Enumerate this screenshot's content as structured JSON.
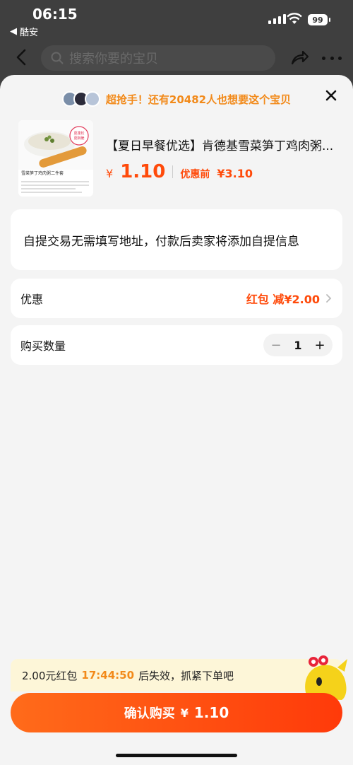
{
  "status_bar": {
    "time": "06:15",
    "back_app": "酷安",
    "battery": "99"
  },
  "nav": {
    "search_placeholder": "搜索你要的宝贝"
  },
  "sheet": {
    "promo_text": "超抢手！还有20482人也想要这个宝贝",
    "product": {
      "title": "【夏日早餐优选】肯德基雪菜笋丁鸡肉粥...",
      "thumb_caption": "雪菜笋丁鸡肉粥二件套",
      "price_symbol": "¥",
      "price": "1.10",
      "original_label": "优惠前",
      "original_price": "¥3.10"
    },
    "pickup_notice": "自提交易无需填写地址，付款后卖家将添加自提信息",
    "discount": {
      "label": "优惠",
      "value": "红包 减¥2.00"
    },
    "quantity": {
      "label": "购买数量",
      "value": "1",
      "minus": "−",
      "plus": "+"
    },
    "timer": {
      "prefix": "2.00元红包",
      "countdown": "17:44:50",
      "suffix": "后失效，抓紧下单吧"
    },
    "cta": {
      "label": "确认购买",
      "symbol": "¥",
      "price": "1.10"
    }
  },
  "colors": {
    "accent": "#ff4a0a",
    "promo": "#f28a1a",
    "cta_start": "#ff6b1a",
    "cta_end": "#ff3a0a"
  }
}
